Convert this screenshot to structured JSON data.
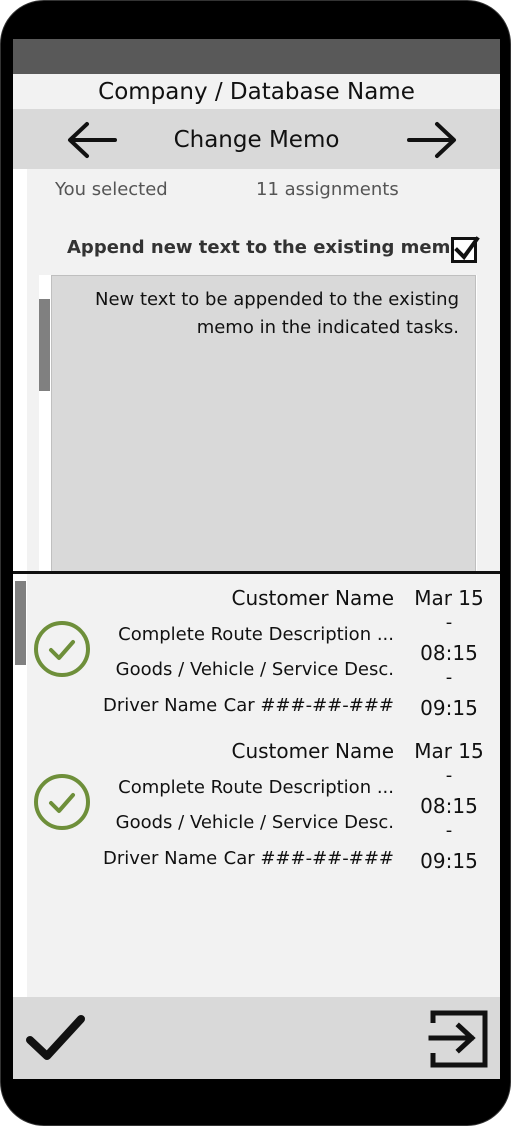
{
  "app": {
    "title": "Company / Database Name"
  },
  "toolbar": {
    "title": "Change Memo",
    "prev_icon": "arrow-left-icon",
    "next_icon": "arrow-right-icon"
  },
  "selection": {
    "label": "You selected",
    "count": "11 assignments"
  },
  "append": {
    "label": "Append new text to the existing memo",
    "checked": true
  },
  "memo": {
    "text": "New text to be appended to the existing\nmemo in the indicated tasks."
  },
  "assignments": [
    {
      "customer": "Customer Name",
      "route": "Complete Route Description ...",
      "goods": "Goods / Vehicle / Service Desc.",
      "driver": "Driver Name",
      "car": "Car ###-##-###",
      "date": "Mar 15",
      "dash": "-",
      "from": "08:15",
      "to": "09:15",
      "status_icon": "check-circle-icon",
      "status_color": "#6e8f3a"
    },
    {
      "customer": "Customer Name",
      "route": "Complete Route Description ...",
      "goods": "Goods / Vehicle / Service Desc.",
      "driver": "Driver Name",
      "car": "Car ###-##-###",
      "date": "Mar 15",
      "dash": "-",
      "from": "08:15",
      "to": "09:15",
      "status_icon": "check-circle-icon",
      "status_color": "#6e8f3a"
    }
  ],
  "bottombar": {
    "confirm_icon": "checkmark-icon",
    "exit_icon": "exit-icon"
  },
  "colors": {
    "status_bar": "#595959",
    "toolbar": "#d9d9d9",
    "background": "#f2f2f2",
    "accent_green": "#6e8f3a"
  }
}
